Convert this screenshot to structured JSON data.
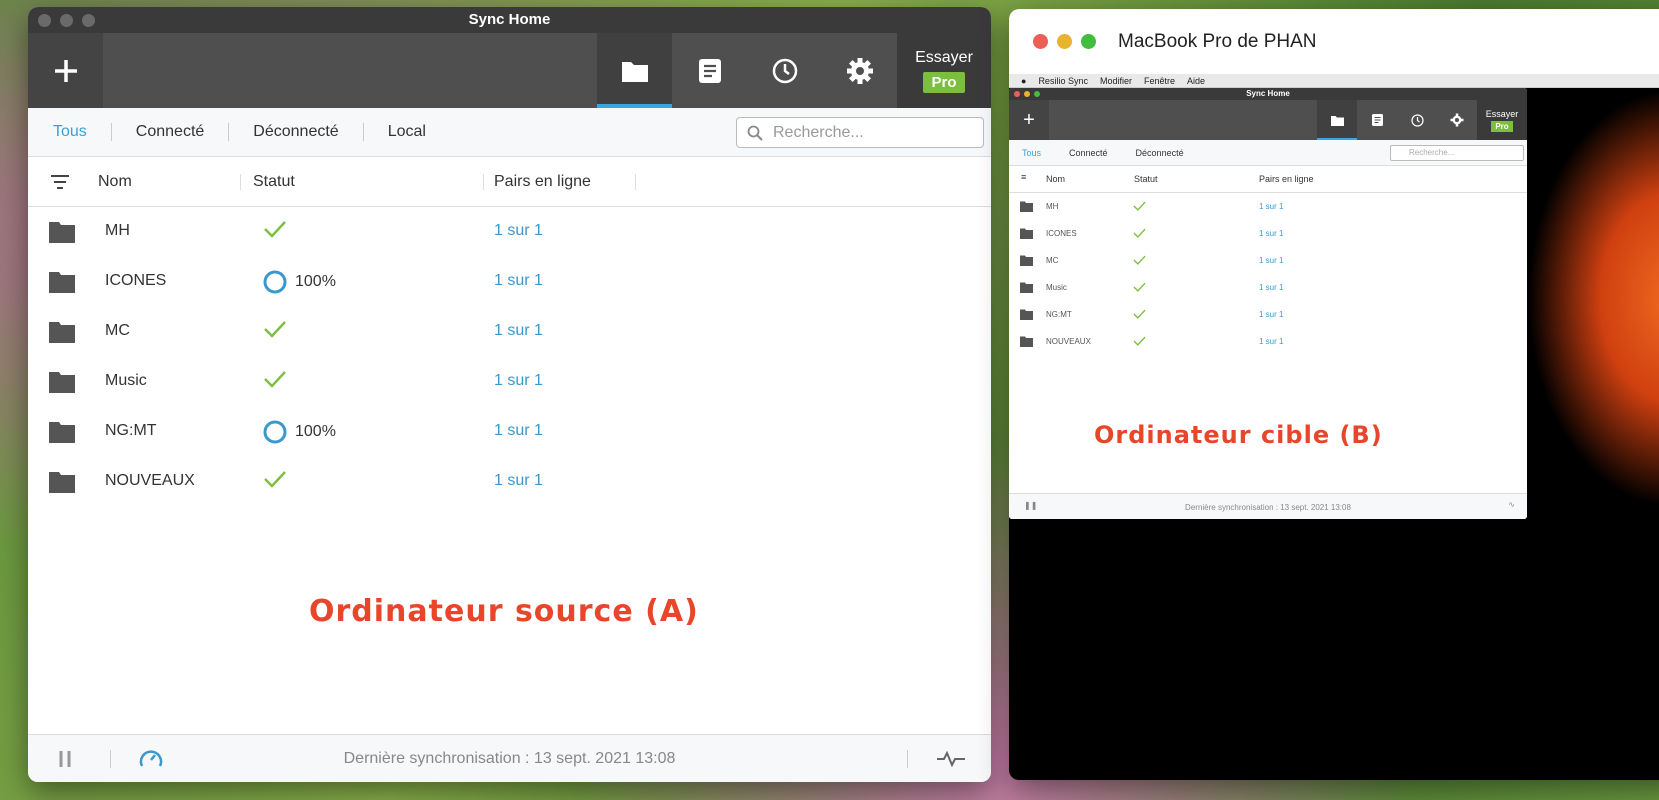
{
  "windowA": {
    "title": "Sync Home",
    "toolbar": {
      "try_label": "Essayer",
      "pro_label": "Pro"
    },
    "filters": [
      "Tous",
      "Connecté",
      "Déconnecté",
      "Local"
    ],
    "search_placeholder": "Recherche...",
    "columns": {
      "name": "Nom",
      "status": "Statut",
      "peers": "Pairs en ligne"
    },
    "rows": [
      {
        "name": "MH",
        "status": "check",
        "status_text": "",
        "peers": "1 sur 1"
      },
      {
        "name": "ICONES",
        "status": "ring",
        "status_text": "100%",
        "peers": "1 sur 1"
      },
      {
        "name": "MC",
        "status": "check",
        "status_text": "",
        "peers": "1 sur 1"
      },
      {
        "name": "Music",
        "status": "check",
        "status_text": "",
        "peers": "1 sur 1"
      },
      {
        "name": "NG:MT",
        "status": "ring",
        "status_text": "100%",
        "peers": "1 sur 1"
      },
      {
        "name": "NOUVEAUX",
        "status": "check",
        "status_text": "",
        "peers": "1 sur 1"
      }
    ],
    "footer_text": "Dernière synchronisation : 13 sept. 2021 13:08"
  },
  "label_source": "Ordinateur source (A)",
  "label_target": "Ordinateur cible (B)",
  "windowB": {
    "title": "MacBook Pro de PHAN",
    "menu": [
      "Resilio Sync",
      "Modifier",
      "Fenêtre",
      "Aide"
    ],
    "app_title": "Sync Home",
    "try_label": "Essayer",
    "pro_label": "Pro",
    "filters": [
      "Tous",
      "Connecté",
      "Déconnecté"
    ],
    "search_placeholder": "Recherche...",
    "columns": {
      "name": "Nom",
      "status": "Statut",
      "peers": "Pairs en ligne"
    },
    "rows": [
      {
        "name": "MH",
        "peers": "1 sur 1"
      },
      {
        "name": "ICONES",
        "peers": "1 sur 1"
      },
      {
        "name": "MC",
        "peers": "1 sur 1"
      },
      {
        "name": "Music",
        "peers": "1 sur 1"
      },
      {
        "name": "NG:MT",
        "peers": "1 sur 1"
      },
      {
        "name": "NOUVEAUX",
        "peers": "1 sur 1"
      }
    ],
    "footer_text": "Dernière synchronisation : 13 sept. 2021 13:08"
  },
  "colors": {
    "accent": "#3aa6e0",
    "check": "#7cbf3f",
    "label": "#e8462a"
  }
}
